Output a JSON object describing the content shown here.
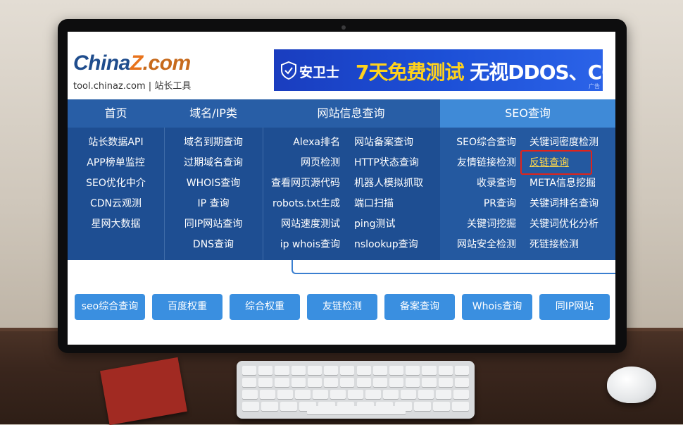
{
  "logo": {
    "main_a": "China",
    "main_z": "Z",
    "main_b": ".com",
    "sub": "tool.chinaz.com | 站长工具"
  },
  "banner": {
    "brand": "安卫士",
    "text_a": "7天免费测试",
    "text_b": " 无视DDOS、CC",
    "ad": "广告"
  },
  "nav": {
    "headers": [
      "首页",
      "域名/IP类",
      "网站信息查询",
      "SEO查询"
    ],
    "active_header": "SEO查询",
    "col1": [
      "站长数据API",
      "APP榜单监控",
      "SEO优化中介",
      "CDN云观测",
      "星网大数据"
    ],
    "col2": [
      "域名到期查询",
      "过期域名查询",
      "WHOIS查询",
      "IP 查询",
      "同IP网站查询",
      "DNS查询"
    ],
    "col3a": [
      "Alexa排名",
      "网页检测",
      "查看网页源代码",
      "robots.txt生成",
      "网站速度测试",
      "ip whois查询"
    ],
    "col3b": [
      "网站备案查询",
      "HTTP状态查询",
      "机器人模拟抓取",
      "端口扫描",
      "ping测试",
      "nslookup查询"
    ],
    "col4a": [
      "SEO综合查询",
      "友情链接检测",
      "收录查询",
      "PR查询",
      "关键词挖掘",
      "网站安全检测"
    ],
    "col4b": [
      "关键词密度检测",
      "反链查询",
      "META信息挖掘",
      "关键词排名查询",
      "关键词优化分析",
      "死链接检测"
    ],
    "highlighted_item": "反链查询"
  },
  "buttons": [
    "seo综合查询",
    "百度权重",
    "综合权重",
    "友链检测",
    "备案查询",
    "Whois查询",
    "同IP网站"
  ],
  "colors": {
    "nav_bg": "#1e4e92",
    "nav_head": "#285ea6",
    "nav_active": "#3f8ad7",
    "button": "#3a8fe0",
    "highlight": "#e0241b"
  }
}
